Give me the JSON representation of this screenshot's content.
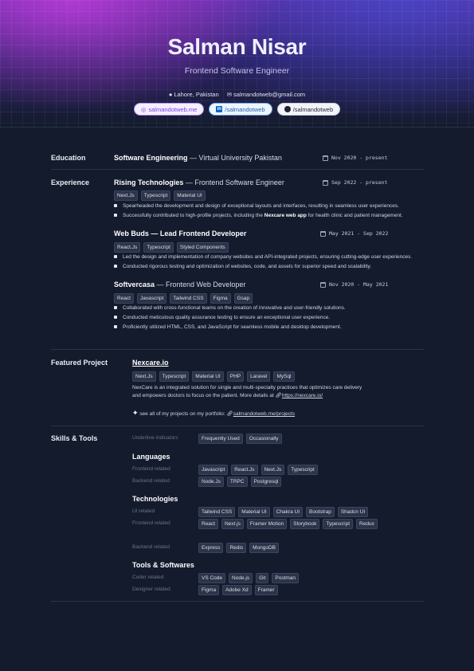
{
  "header": {
    "name": "Salman Nisar",
    "role": "Frontend Software Engineer",
    "location": "Lahore, Pakistan",
    "email": "salmandotweb@gmail.com",
    "links": [
      {
        "label": "salmandotweb.me",
        "icon": "globe-icon"
      },
      {
        "label": "/salmandotweb",
        "icon": "linkedin-icon"
      },
      {
        "label": "/salmandotweb",
        "icon": "github-icon"
      }
    ]
  },
  "education": {
    "title": "Education",
    "degree": "Software Engineering",
    "school": " — Virtual University Pakistan",
    "date": "Nov 2020 - present"
  },
  "experience": {
    "title": "Experience",
    "jobs": [
      {
        "company": "Rising Technologies",
        "role": " — Frontend Software Engineer",
        "date": "Sep 2022 - present",
        "tags": [
          "Next.Js",
          "Typescript",
          "Material UI"
        ],
        "bullets": [
          "Spearheaded the development and design of exceptional layouts and interfaces, resulting in seamless user experiences.",
          "Successfully contributed to high-profile projects, including the ",
          "Nexcare web app",
          " for health clinic and patient management."
        ]
      },
      {
        "company": "Web Buds",
        "role": " — Lead Frontend Developer",
        "date": "May 2021 - Sep 2022",
        "tags": [
          "React.Js",
          "Typescript",
          "Styled Components"
        ],
        "bullets": [
          "Led the design and implementation of company websites and API-integrated projects, ensuring cutting-edge user experiences.",
          "Conducted rigorous testing and optimization of websites, code, and assets for superior speed and scalability."
        ]
      },
      {
        "company": "Softvercasa",
        "role": " — Frontend Web Developer",
        "date": "Nov 2020 - May 2021",
        "tags": [
          "React",
          "Javascript",
          "Tailwind CSS",
          "Figma",
          "Gsap"
        ],
        "bullets": [
          "Collaborated with cross-functional teams on the creation of innovative and user-friendly solutions.",
          "Conducted meticulous quality assurance testing to ensure an exceptional user experience.",
          "Proficiently utilized HTML, CSS, and JavaScript for seamless mobile and desktop development."
        ]
      }
    ]
  },
  "project": {
    "title": "Featured Project",
    "name": "Nexcare.io",
    "tags": [
      "Next.Js",
      "Typescript",
      "Material UI",
      "PHP",
      "Laravel",
      "MySql"
    ],
    "desc1": "NexCare is an integrated solution for single and multi-specialty practices that optimizes care delivery",
    "desc2": "and empowers doctors to focus on the patient. More details at ",
    "desc_link": "https://nexcare.io/",
    "portfolio_text": "see all of my projects on my portfolio: ",
    "portfolio_link": "salmandotweb.me/projects"
  },
  "skills": {
    "title": "Skills & Tools",
    "indicator_label": "Underline indicators",
    "indicators": [
      "Frequently Used",
      "Occasionally"
    ],
    "languages": {
      "title": "Languages",
      "frontend_label": "Frontend related",
      "frontend": [
        "Javascript",
        "React.Js",
        "Next.Js",
        "Typescript"
      ],
      "backend_label": "Backend related",
      "backend": [
        "Node.Js",
        "TRPC",
        "Postgresql"
      ]
    },
    "technologies": {
      "title": "Technologies",
      "ui_label": "UI related",
      "ui": [
        "Tailwind CSS",
        "Material UI",
        "Chakra UI",
        "Bootstrap",
        "Shadcn UI"
      ],
      "frontend_label": "Frontend related",
      "frontend": [
        "React",
        "Next.js",
        "Framer Motion",
        "Storybook",
        "Typescript",
        "Redux"
      ],
      "backend_label": "Backend related",
      "backend": [
        "Express",
        "Redis",
        "MongoDB"
      ]
    },
    "tools": {
      "title": "Tools & Softwares",
      "coder_label": "Coder related",
      "coder": [
        "VS Code",
        "Node.js",
        "Git",
        "Postman"
      ],
      "designer_label": "Designer related",
      "designer": [
        "Figma",
        "Adobe Xd",
        "Framer"
      ]
    }
  }
}
